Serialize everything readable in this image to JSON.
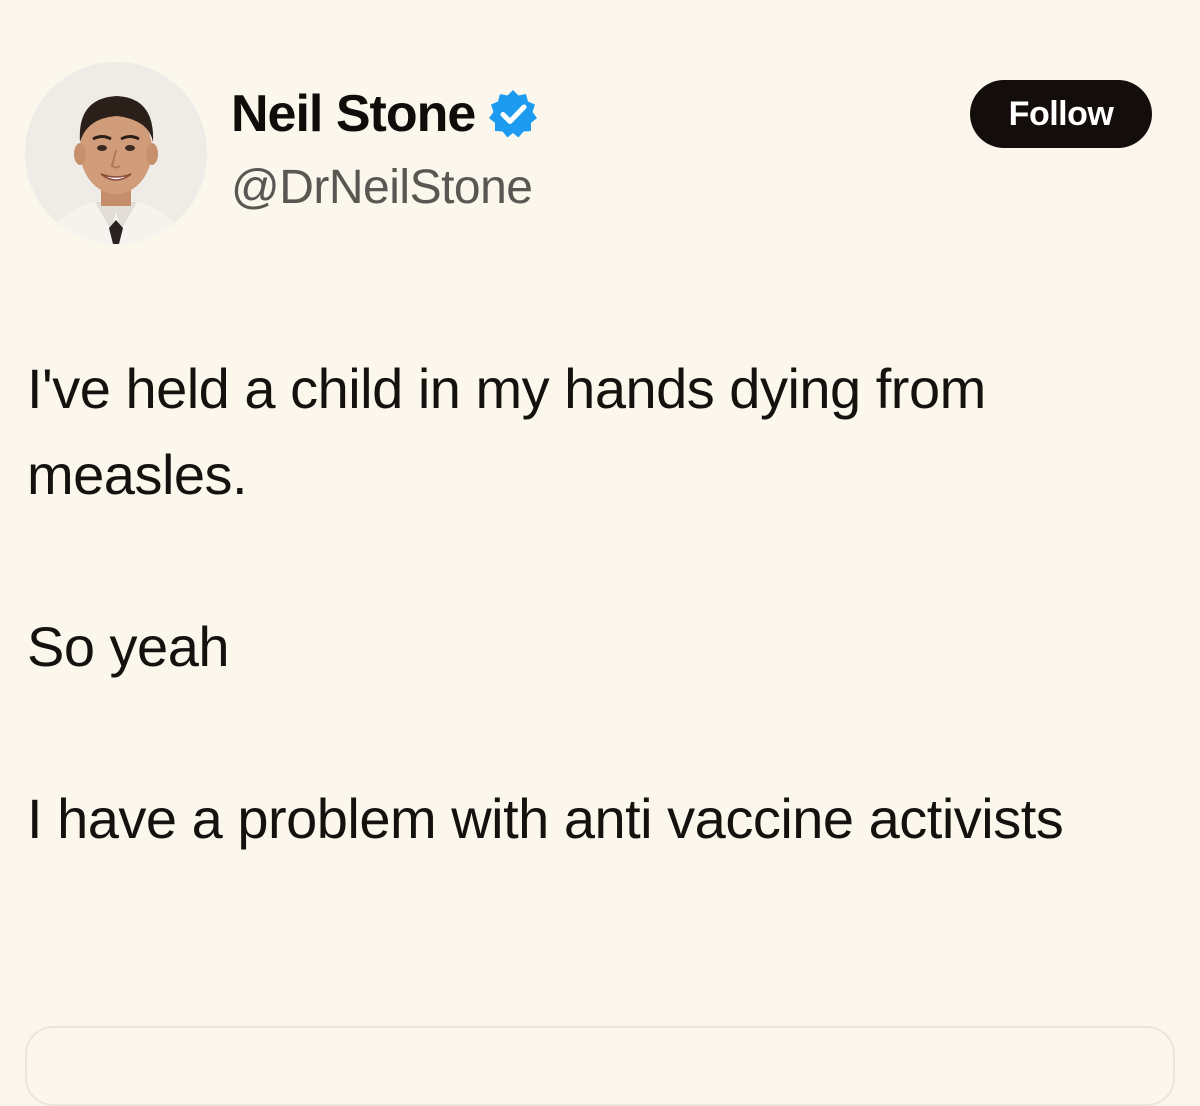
{
  "author": {
    "display_name": "Neil Stone",
    "handle": "@DrNeilStone",
    "verified_icon": "verified-badge-icon",
    "avatar_icon": "profile-photo"
  },
  "actions": {
    "follow_label": "Follow"
  },
  "tweet": {
    "paragraphs": [
      "I've held a child in my hands dying from measles.",
      "So yeah",
      "I have a problem with anti vaccine activists"
    ]
  },
  "colors": {
    "background": "#fcf7ec",
    "text": "#15110e",
    "handle": "#5a5753",
    "follow_button": "#130e0c",
    "verified_blue": "#1d9bf0"
  }
}
